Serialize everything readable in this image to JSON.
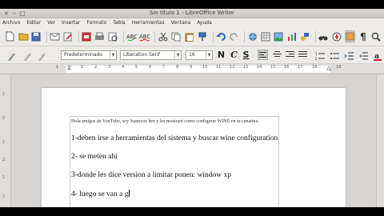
{
  "window": {
    "title": "Sin título 1 - LibreOffice Writer",
    "buttons": {
      "close": "×",
      "minimize": "–",
      "maximize": "□"
    }
  },
  "menubar": {
    "items": [
      "Archivo",
      "Editar",
      "Ver",
      "Insertar",
      "Formato",
      "Tabla",
      "Herramientas",
      "Ventana",
      "Ayuda"
    ]
  },
  "toolbar": {
    "icons": [
      "new-document",
      "open-folder",
      "save",
      "email",
      "edit-mode",
      "export-pdf",
      "print",
      "print-preview",
      "spellcheck",
      "autospellcheck",
      "cut",
      "copy",
      "paste",
      "clone-format",
      "undo",
      "redo",
      "hyperlink",
      "table",
      "image",
      "chart",
      "draw-functions",
      "find-replace",
      "navigator",
      "gallery",
      "formatting-marks",
      "zoom"
    ]
  },
  "formatting": {
    "style_value": "Predeterminado",
    "font_value": "Liberation Serif",
    "size_value": "16",
    "bold": "N",
    "italic": "C",
    "underline": "S"
  },
  "ruler": {
    "numbers": [
      "1",
      "1",
      "2",
      "3",
      "4",
      "5",
      "6",
      "7",
      "8",
      "9",
      "10",
      "11",
      "12",
      "13",
      "14",
      "15",
      "16",
      "17",
      "18",
      "19"
    ]
  },
  "vruler": {
    "numbers": [
      "1",
      "2",
      "1",
      "2",
      "1",
      "2"
    ]
  },
  "document": {
    "lines": [
      "Hola amigos de YouTube, soy Juancrax hez y les mostraré como configurar WINE en tu canaima",
      "1-deben irse a herramientas del sistema y buscar wine configuration",
      "2- se meten ahi",
      "3-donde les dice version a limitar ponen: window xp",
      "4- luego se van a g"
    ]
  }
}
